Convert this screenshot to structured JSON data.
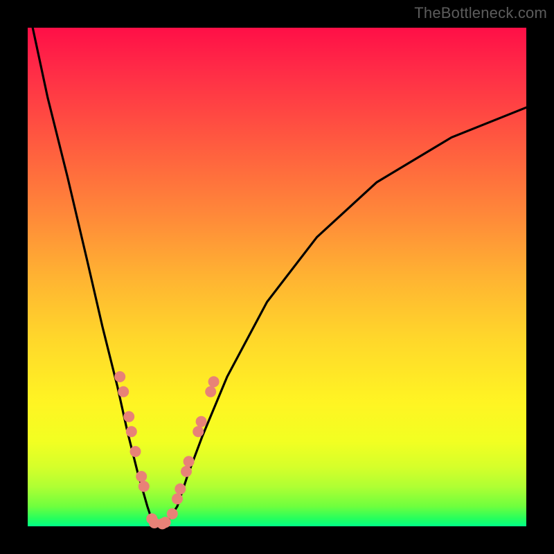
{
  "watermark": "TheBottleneck.com",
  "chart_data": {
    "type": "line",
    "title": "",
    "xlabel": "",
    "ylabel": "",
    "xlim": [
      0,
      100
    ],
    "ylim": [
      0,
      100
    ],
    "series": [
      {
        "name": "bottleneck-curve",
        "x": [
          1,
          4,
          8,
          12,
          15,
          18,
          20,
          22,
          24,
          25,
          26,
          27,
          28,
          30,
          32,
          35,
          40,
          48,
          58,
          70,
          85,
          100
        ],
        "y": [
          100,
          86,
          70,
          53,
          40,
          28,
          19,
          11,
          4,
          1,
          0,
          0,
          1,
          4,
          10,
          18,
          30,
          45,
          58,
          69,
          78,
          84
        ]
      }
    ],
    "markers": {
      "name": "highlight-dots",
      "points": [
        {
          "x": 18.5,
          "y": 30
        },
        {
          "x": 19.2,
          "y": 27
        },
        {
          "x": 20.3,
          "y": 22
        },
        {
          "x": 20.8,
          "y": 19
        },
        {
          "x": 21.6,
          "y": 15
        },
        {
          "x": 22.8,
          "y": 10
        },
        {
          "x": 23.3,
          "y": 8
        },
        {
          "x": 24.9,
          "y": 1.5
        },
        {
          "x": 25.4,
          "y": 0.7
        },
        {
          "x": 27.0,
          "y": 0.5
        },
        {
          "x": 27.6,
          "y": 0.8
        },
        {
          "x": 29.0,
          "y": 2.5
        },
        {
          "x": 30.0,
          "y": 5.5
        },
        {
          "x": 30.6,
          "y": 7.5
        },
        {
          "x": 31.8,
          "y": 11
        },
        {
          "x": 32.3,
          "y": 13
        },
        {
          "x": 34.2,
          "y": 19
        },
        {
          "x": 34.8,
          "y": 21
        },
        {
          "x": 36.7,
          "y": 27
        },
        {
          "x": 37.3,
          "y": 29
        }
      ]
    },
    "background_gradient": {
      "top": "#ff0f47",
      "mid": "#ffd62b",
      "bottom": "#00ff88"
    }
  }
}
